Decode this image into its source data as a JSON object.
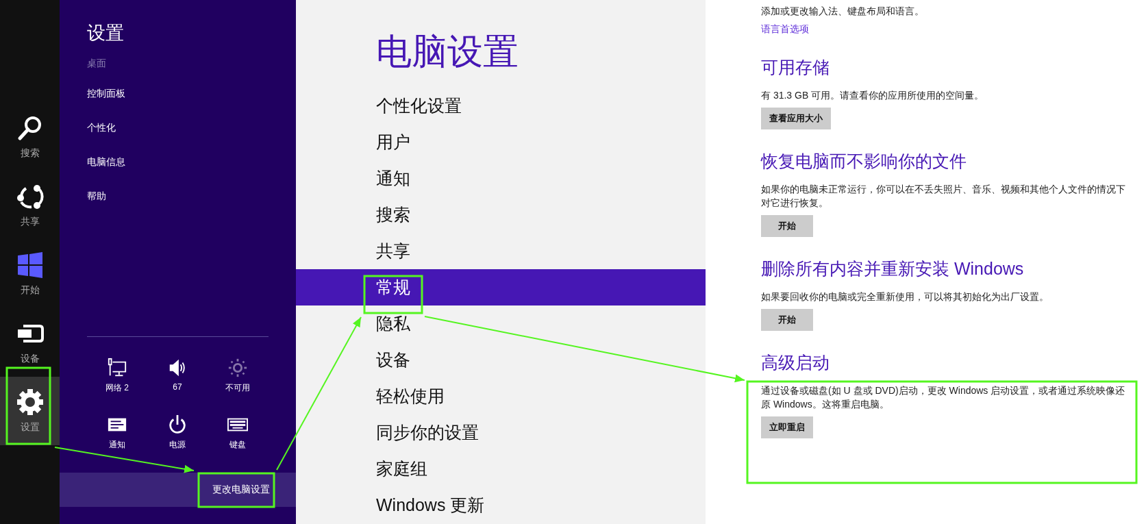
{
  "charms": [
    {
      "label": "搜索",
      "kind": "search",
      "selected": false
    },
    {
      "label": "共享",
      "kind": "share",
      "selected": false
    },
    {
      "label": "开始",
      "kind": "start",
      "selected": false
    },
    {
      "label": "设备",
      "kind": "devices",
      "selected": false
    },
    {
      "label": "设置",
      "kind": "settings",
      "selected": true
    }
  ],
  "settings_pane": {
    "title": "设置",
    "context": "桌面",
    "items": [
      "控制面板",
      "个性化",
      "电脑信息",
      "帮助"
    ],
    "quick_settings": [
      {
        "label": "网络  2",
        "kind": "network",
        "disabled": false
      },
      {
        "label": "67",
        "kind": "volume",
        "disabled": false
      },
      {
        "label": "不可用",
        "kind": "brightness",
        "disabled": true
      },
      {
        "label": "通知",
        "kind": "notifications",
        "disabled": false
      },
      {
        "label": "电源",
        "kind": "power",
        "disabled": false
      },
      {
        "label": "键盘",
        "kind": "keyboard",
        "disabled": false
      }
    ],
    "change_pc_settings": "更改电脑设置"
  },
  "pc_settings": {
    "title": "电脑设置",
    "nav": [
      {
        "label": "个性化设置",
        "selected": false
      },
      {
        "label": "用户",
        "selected": false
      },
      {
        "label": "通知",
        "selected": false
      },
      {
        "label": "搜索",
        "selected": false
      },
      {
        "label": "共享",
        "selected": false
      },
      {
        "label": "常规",
        "selected": true
      },
      {
        "label": "隐私",
        "selected": false
      },
      {
        "label": "设备",
        "selected": false
      },
      {
        "label": "轻松使用",
        "selected": false
      },
      {
        "label": "同步你的设置",
        "selected": false
      },
      {
        "label": "家庭组",
        "selected": false
      },
      {
        "label": "Windows 更新",
        "selected": false
      }
    ]
  },
  "general": {
    "intro_text": "添加或更改输入法、键盘布局和语言。",
    "link": "语言首选项",
    "sections": [
      {
        "heading": "可用存储",
        "description": "有 31.3 GB 可用。请查看你的应用所使用的空间量。",
        "button": "查看应用大小"
      },
      {
        "heading": "恢复电脑而不影响你的文件",
        "description": "如果你的电脑未正常运行，你可以在不丢失照片、音乐、视频和其他个人文件的情况下对它进行恢复。",
        "button": "开始"
      },
      {
        "heading": "删除所有内容并重新安装 Windows",
        "description": "如果要回收你的电脑或完全重新使用，可以将其初始化为出厂设置。",
        "button": "开始"
      },
      {
        "heading": "高级启动",
        "description": "通过设备或磁盘(如 U 盘或 DVD)启动，更改 Windows 启动设置，或者通过系统映像还原 Windows。这将重启电脑。",
        "button": "立即重启"
      }
    ]
  }
}
